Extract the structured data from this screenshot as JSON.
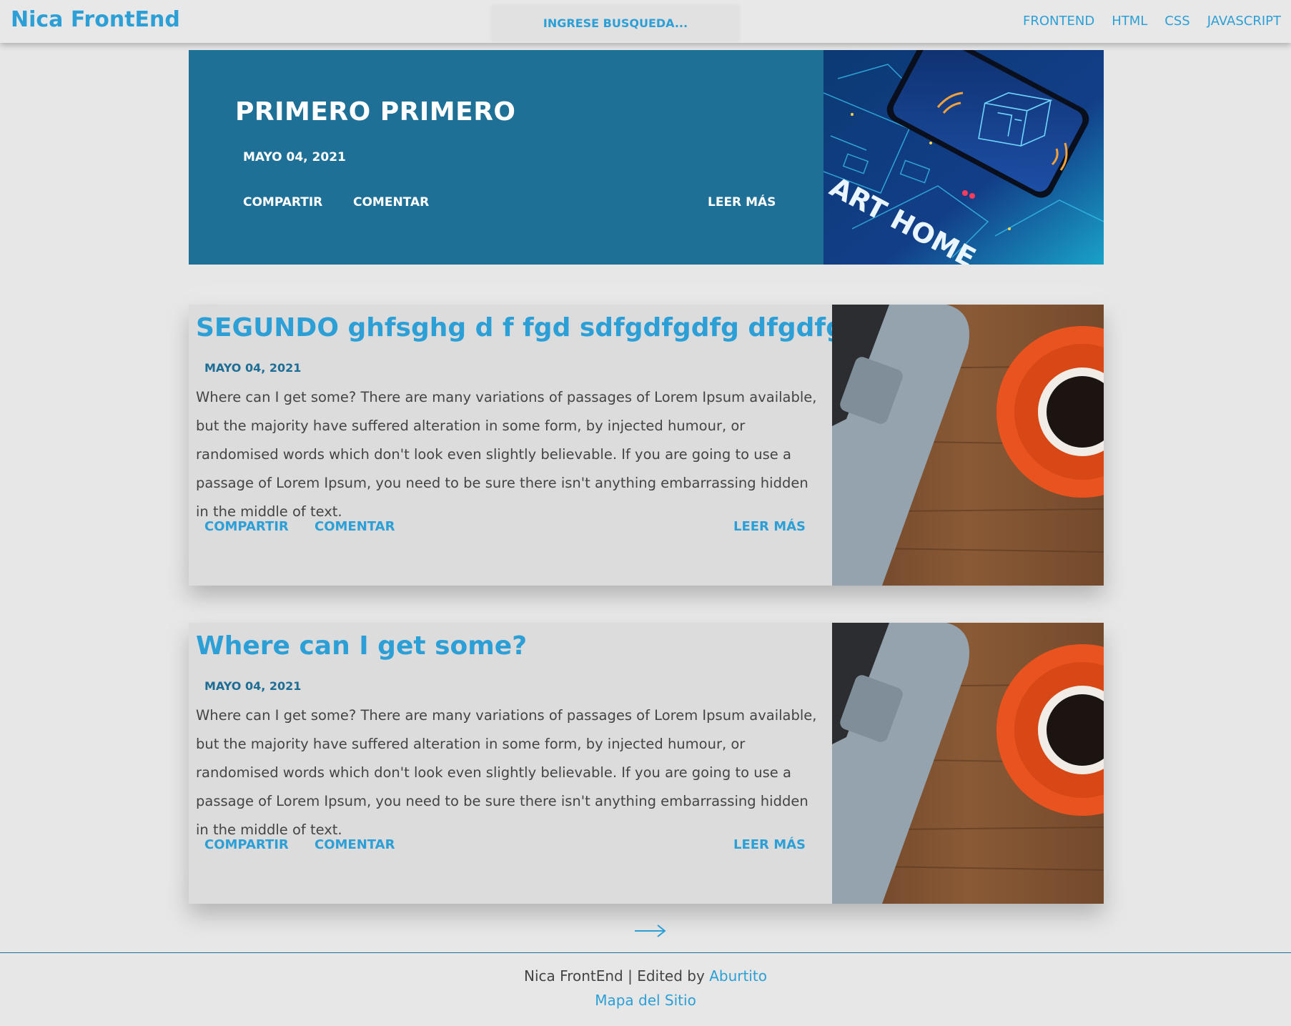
{
  "header": {
    "brand": "Nica FrontEnd",
    "search_placeholder": "INGRESE BUSQUEDA...",
    "nav": [
      "FRONTEND",
      "HTML",
      "CSS",
      "JAVASCRIPT"
    ]
  },
  "hero": {
    "title": "PRIMERO PRIMERO",
    "date": "MAYO 04, 2021",
    "share": "COMPARTIR",
    "comment": "COMENTAR",
    "read_more": "LEER MÁS",
    "image_caption": "ART HOME"
  },
  "posts": [
    {
      "title": "SEGUNDO ghfsghg d f fgd sdfgdfgdfg dfgdfgert",
      "date": "MAYO 04, 2021",
      "body": "Where can I get some? There are many variations of passages of Lorem Ipsum available, but the majority have suffered alteration in some form, by injected humour, or randomised words which don't look even slightly believable. If you are going to use a passage of Lorem Ipsum, you need to be sure there isn't anything embarrassing hidden in the middle of text.",
      "share": "COMPARTIR",
      "comment": "COMENTAR",
      "read_more": "LEER MÁS"
    },
    {
      "title": "Where can I get some?",
      "date": "MAYO 04, 2021",
      "body": "Where can I get some? There are many variations of passages of Lorem Ipsum available, but the majority have suffered alteration in some form, by injected humour, or randomised words which don't look even slightly believable. If you are going to use a passage of Lorem Ipsum, you need to be sure there isn't anything embarrassing hidden in the middle of text.",
      "share": "COMPARTIR",
      "comment": "COMENTAR",
      "read_more": "LEER MÁS"
    }
  ],
  "pagination": {
    "next_icon": "arrow-right-icon"
  },
  "footer": {
    "text": "Nica FrontEnd | Edited by ",
    "author": "Aburtito",
    "sitemap": "Mapa del Sitio"
  },
  "colors": {
    "accent": "#2c9fd6",
    "hero_bg": "#1e7096",
    "page_bg": "#e7e7e7",
    "card_bg": "#dcdcdc"
  }
}
